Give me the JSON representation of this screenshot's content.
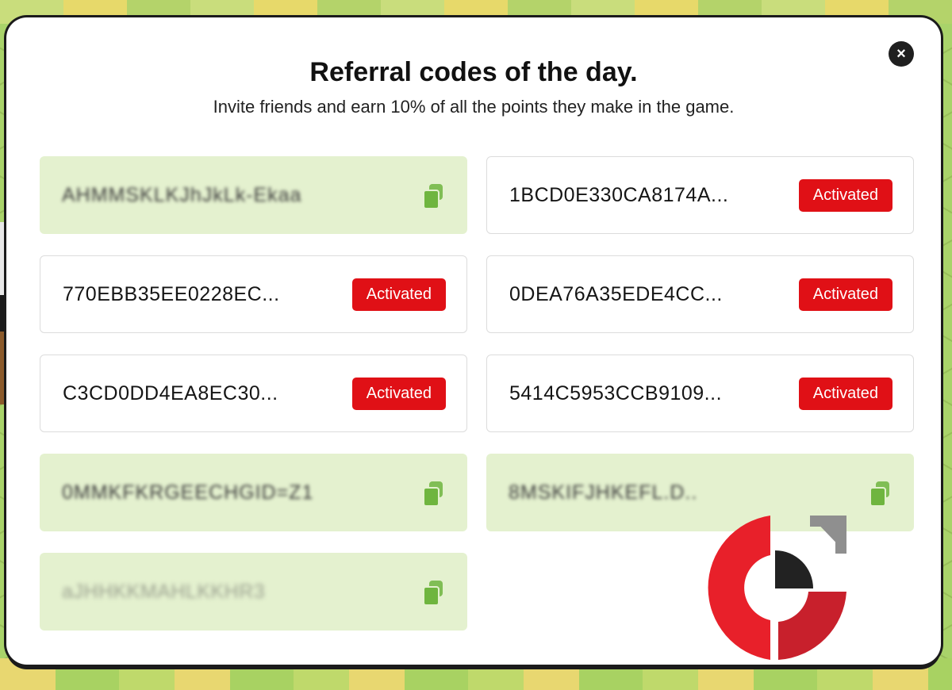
{
  "modal": {
    "title": "Referral codes of the day.",
    "subtitle": "Invite friends and earn 10% of all the points they make in the game.",
    "close_icon": "×"
  },
  "codes": [
    {
      "code": "AHMMSKLKJhJkLk-Ekaa",
      "status": "available",
      "copy_icon": "copy-icon"
    },
    {
      "code": "1BCD0E330CA8174A...",
      "status": "activated",
      "badge": "Activated"
    },
    {
      "code": "770EBB35EE0228EC...",
      "status": "activated",
      "badge": "Activated"
    },
    {
      "code": "0DEA76A35EDE4CC...",
      "status": "activated",
      "badge": "Activated"
    },
    {
      "code": "C3CD0DD4EA8EC30...",
      "status": "activated",
      "badge": "Activated"
    },
    {
      "code": "5414C5953CCB9109...",
      "status": "activated",
      "badge": "Activated"
    },
    {
      "code": "0MMKFKRGEECHGID=Z1",
      "status": "available",
      "copy_icon": "copy-icon"
    },
    {
      "code": "8MSKIFJHKEFL.D..",
      "status": "available",
      "copy_icon": "copy-icon"
    },
    {
      "code": "aJHHKKMAHLKKHR3",
      "status": "available",
      "copy_icon": "copy-icon"
    }
  ],
  "colors": {
    "activated_badge": "#e01016",
    "available_card": "#e4f1cf",
    "copy_icon": "#6fb53f",
    "logo_red": "#e8202a",
    "logo_dark_red": "#c8202c",
    "logo_black": "#222222",
    "logo_grey": "#8f8f8f"
  }
}
